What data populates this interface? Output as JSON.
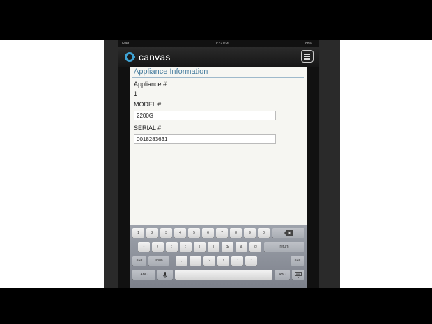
{
  "status_bar": {
    "left": "iPad",
    "time": "1:22 PM",
    "right": "88%"
  },
  "app": {
    "brand": "canvas",
    "menu_icon": "hamburger-menu-icon"
  },
  "form": {
    "section_title": "Appliance Information",
    "fields": [
      {
        "label": "Appliance #",
        "value": "1"
      },
      {
        "label": "MODEL #",
        "value": "2200G"
      },
      {
        "label": "SERIAL #",
        "value": "0018283631"
      }
    ]
  },
  "keyboard": {
    "row1": [
      "1",
      "2",
      "3",
      "4",
      "5",
      "6",
      "7",
      "8",
      "9",
      "0"
    ],
    "delete_icon": "backspace-icon",
    "row2": [
      "-",
      "/",
      ":",
      ";",
      "(",
      ")",
      "$",
      "&",
      "@"
    ],
    "return_label": "return",
    "row3_left": "#+=",
    "undo_label": "undo",
    "row3": [
      ",",
      ".",
      "?",
      "!",
      "'",
      "\""
    ],
    "row3_right": "#+=",
    "abc_left": "ABC",
    "mic_icon": "microphone-icon",
    "abc_right": "ABC",
    "hide_keyboard_icon": "hide-keyboard-icon"
  },
  "colors": {
    "accent": "#3fa4d6",
    "section_title": "#4a7fa0",
    "letterbox": "#000000"
  }
}
